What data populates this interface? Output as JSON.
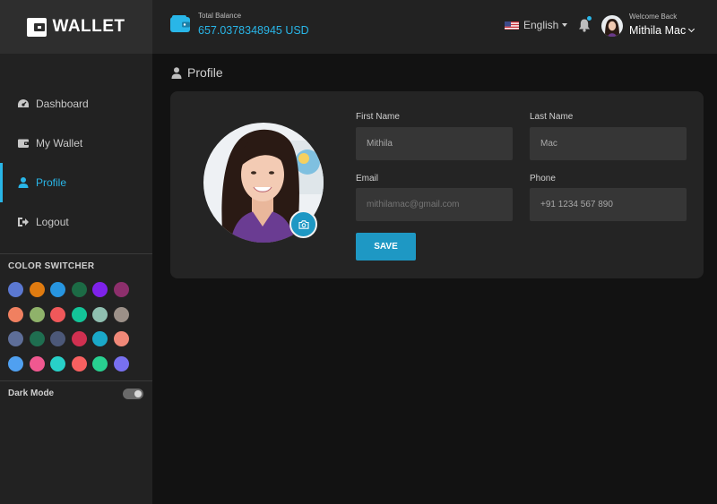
{
  "brand": {
    "name": "WALLET"
  },
  "sidebar": {
    "items": [
      {
        "label": "Dashboard",
        "icon": "dashboard-icon"
      },
      {
        "label": "My Wallet",
        "icon": "wallet-icon"
      },
      {
        "label": "Profile",
        "icon": "user-icon",
        "active": true
      },
      {
        "label": "Logout",
        "icon": "logout-icon"
      }
    ],
    "color_switcher_title": "COLOR SWITCHER",
    "swatches": [
      "#5b78d1",
      "#e07b10",
      "#2795e0",
      "#1c6b45",
      "#7e22ea",
      "#8d2f6c",
      "#f08060",
      "#8fb26a",
      "#f0585a",
      "#13c498",
      "#8fbfb0",
      "#9c9088",
      "#5e6e98",
      "#1f6e50",
      "#4c5878",
      "#d03050",
      "#1aa8c8",
      "#f08878",
      "#50a0f0",
      "#f05890",
      "#28d0c8",
      "#f86060",
      "#28d090",
      "#7870f0"
    ],
    "dark_mode_label": "Dark Mode",
    "dark_mode_on": true
  },
  "header": {
    "balance_label": "Total Balance",
    "balance_value": "657.0378348945 USD",
    "language": "English",
    "welcome": "Welcome Back",
    "username": "Mithila Mac"
  },
  "page": {
    "title": "Profile"
  },
  "form": {
    "first_name_label": "First Name",
    "first_name_value": "Mithila",
    "last_name_label": "Last Name",
    "last_name_value": "Mac",
    "email_label": "Email",
    "email_placeholder": "mithilamac@gmail.com",
    "phone_label": "Phone",
    "phone_value": "+91 1234 567 890",
    "save_label": "SAVE"
  },
  "colors": {
    "accent": "#29b6e8",
    "button": "#1e98c4",
    "background": "#121212",
    "panel": "#222222"
  }
}
